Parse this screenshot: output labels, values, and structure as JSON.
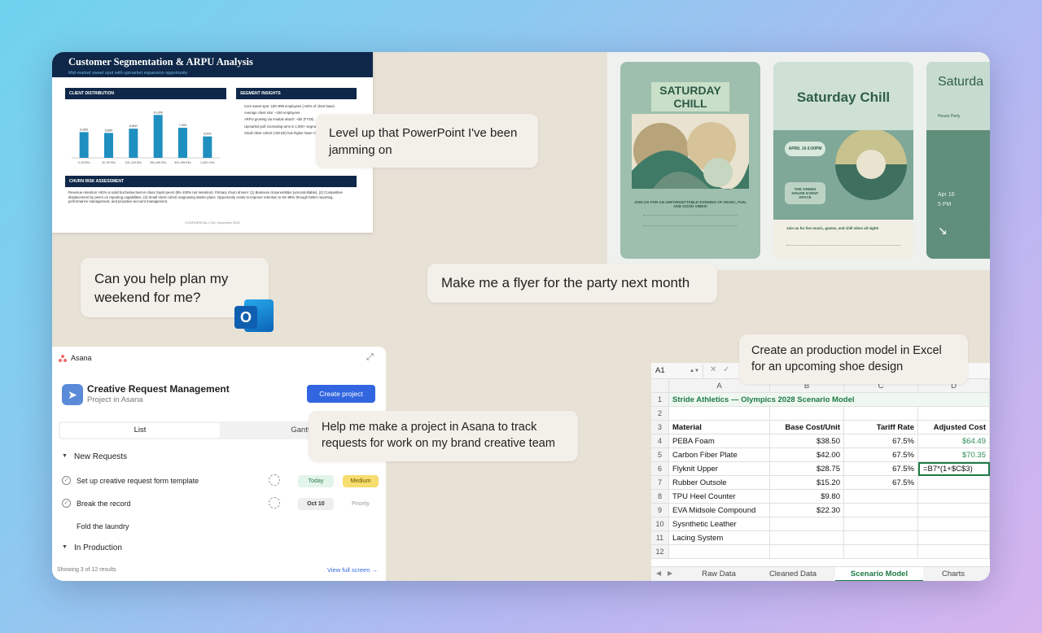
{
  "pptx": {
    "title": "Customer Segmentation & ARPU Analysis",
    "subtitle": "Mid-market sweet spot with upmarket expansion opportunity",
    "client_distribution_header": "CLIENT DISTRIBUTION",
    "segment_insights_header": "SEGMENT INSIGHTS",
    "insights": [
      "Core sweet spot: 100–999 employees (~60% of client base)",
      "Average client size: ~150 employees",
      "ARPU growing via module attach: ~$X (FY25)",
      "Upmarket pull: increasing wins in 1,000+ segment",
      "Small client cohort (<50 EE) has higher lower CAC"
    ],
    "churn_header": "CHURN RISK ASSESSMENT",
    "churn_text": "Revenue retention >92% is solid but below best-in-class SaaS peers (95–100% net retention). Primary churn drivers: (1) Business closures/M&A (uncontrollable), (2) Competitive displacement by peers on reporting capabilities, (3) Small client cohort outgrowing starter plans. Opportunity exists to improve retention to 94–95% through better reporting, performance management, and proactive account management.",
    "footer": "CONFIDENTIAL | CBI | November 2025"
  },
  "chart_data": {
    "type": "bar",
    "title": "CLIENT DISTRIBUTION",
    "categories": [
      "0–49 EEs",
      "50–99 EEs",
      "100–249 EEs",
      "250–499 EEs",
      "500–999 EEs",
      "1,000+ EEs"
    ],
    "values": [
      6000,
      5800,
      6800,
      10000,
      7000,
      5000
    ],
    "data_labels": [
      "6,000",
      "5,800",
      "6,800",
      "10,000",
      "7,000",
      "5,000"
    ],
    "color": "#1e8fbf",
    "ylim": [
      0,
      11000
    ]
  },
  "bubbles": {
    "powerpoint": "Level up that PowerPoint I've been jamming on",
    "weekend": "Can you help plan my weekend for me?",
    "flyer": "Make me a flyer for the party next month",
    "excel": "Create an production model in Excel for an upcoming shoe design",
    "asana": "Help me make a project in Asana to track requests for work on my brand creative team"
  },
  "flyers": {
    "f1_title": "SATURDAY CHILL",
    "f1_body": "JOIN US FOR AN UNFORGETTABLE EVENING OF MUSIC, FUN, AND GOOD VIBES!",
    "f2_title": "Saturday Chill",
    "f2_tag1": "APRIL 16 6:00PM",
    "f2_tag2": "THE GREEN HOUSE EVENT SPACE",
    "f2_body": "Join us for live music, games, and chill vibes all night!",
    "f3_title": "Saturda",
    "f3_sub": "House Party",
    "f3_date": "Apr 16",
    "f3_time": "5 PM"
  },
  "asana": {
    "app_name": "Asana",
    "project_title": "Creative Request Management",
    "project_subtitle": "Project in Asana",
    "create_button": "Create project",
    "tab_list": "List",
    "tab_gantt": "Gantt",
    "section1": "New Requests",
    "tasks": [
      {
        "name": "Set up creative request form template",
        "due": "Today",
        "priority": "Medium"
      },
      {
        "name": "Break the record",
        "due": "Oct 10",
        "priority": "Priority"
      },
      {
        "name": "Fold the laundry",
        "due": "",
        "priority": ""
      }
    ],
    "section2": "In Production",
    "footer_count": "Showing 3 of 12 results",
    "footer_link": "View full screen"
  },
  "excel": {
    "cell_ref": "A1",
    "col_headers": [
      "A",
      "B",
      "C",
      "D"
    ],
    "rows": [
      [
        "1",
        "Stride Athletics — Olympics 2028 Scenario Model",
        "",
        "",
        ""
      ],
      [
        "2",
        "",
        "",
        "",
        ""
      ],
      [
        "3",
        "Material",
        "Base Cost/Unit",
        "Tariff Rate",
        "Adjusted Cost"
      ],
      [
        "4",
        "PEBA Foam",
        "$38.50",
        "67.5%",
        "$64.49"
      ],
      [
        "5",
        "Carbon Fiber Plate",
        "$42.00",
        "67.5%",
        "$70.35"
      ],
      [
        "6",
        "Flyknit Upper",
        "$28.75",
        "67.5%",
        "=B7*(1+$C$3)"
      ],
      [
        "7",
        "Rubber Outsole",
        "$15.20",
        "67.5%",
        ""
      ],
      [
        "8",
        "TPU Heel Counter",
        "$9.80",
        "",
        ""
      ],
      [
        "9",
        "EVA Midsole Compound",
        "$22.30",
        "",
        ""
      ],
      [
        "10",
        "Sysnthetic Leather",
        "",
        "",
        ""
      ],
      [
        "11",
        "Lacing System",
        "",
        "",
        ""
      ],
      [
        "12",
        "",
        "",
        "",
        ""
      ]
    ],
    "sheet_tabs": [
      "Raw Data",
      "Cleaned Data",
      "Scenario Model",
      "Charts"
    ],
    "active_tab": "Scenario Model",
    "accent_green": "#1f7a45"
  },
  "colors": {
    "navy": "#0f2748",
    "asana_blue": "#3266e0",
    "excel_green": "#2e8b57",
    "background": "#e8e1d6"
  }
}
